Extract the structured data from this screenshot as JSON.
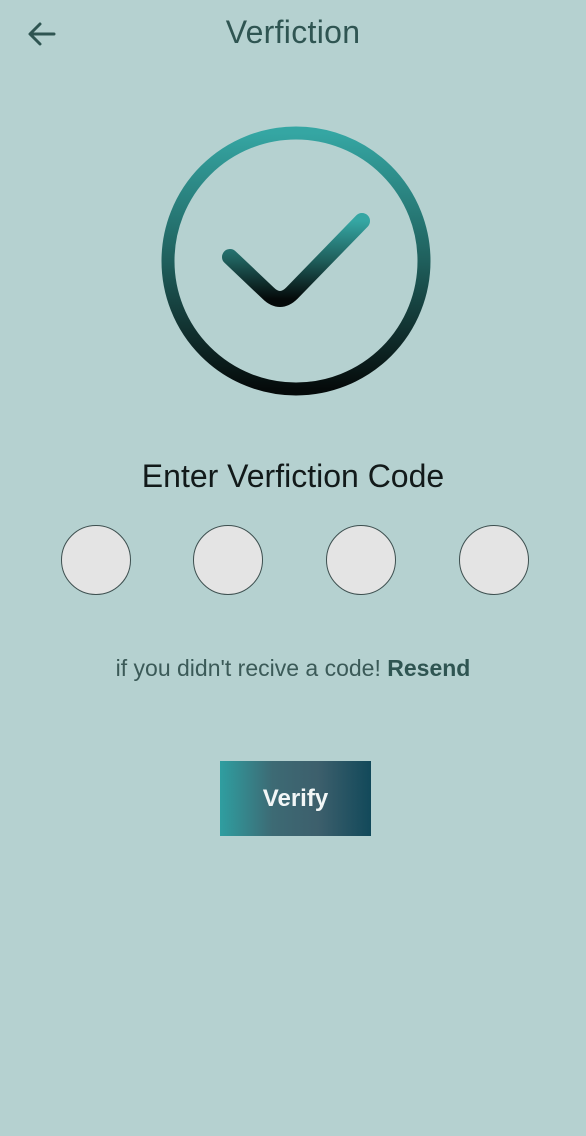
{
  "header": {
    "title": "Verfiction",
    "back_icon": "arrow-left-icon"
  },
  "hero": {
    "icon": "check-circle-icon",
    "gradient_top": "#35a6a3",
    "gradient_bottom": "#050a0a"
  },
  "form": {
    "heading": "Enter Verfiction Code",
    "digits": [
      "",
      "",
      "",
      ""
    ]
  },
  "resend": {
    "prompt": "if you didn't recive a code!",
    "link": "Resend"
  },
  "verify_button": {
    "label": "Verify"
  },
  "colors": {
    "background": "#b5d1d0",
    "accent": "#2f5552"
  }
}
